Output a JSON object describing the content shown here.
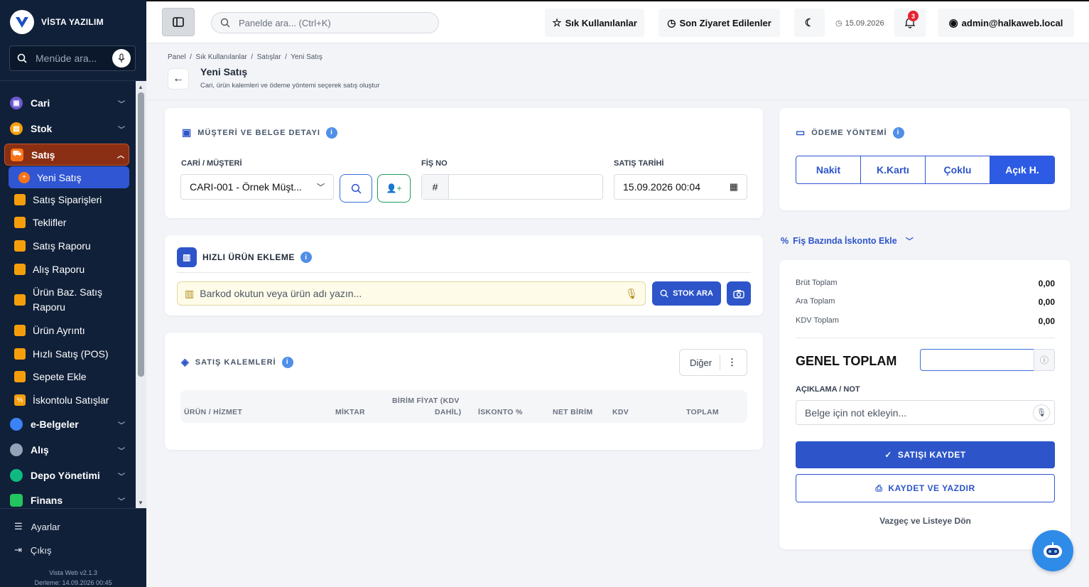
{
  "sidebar": {
    "brand": "VİSTA YAZILIM",
    "search_placeholder": "Menüde ara...",
    "groups": [
      {
        "label": "Cari",
        "color": "#6d5bd0"
      },
      {
        "label": "Stok",
        "color": "#f59e0b"
      },
      {
        "label": "Satış",
        "color": "#f97316"
      }
    ],
    "satis_items": [
      "Yeni Satış",
      "Satış Siparişleri",
      "Teklifler",
      "Satış Raporu",
      "Alış Raporu",
      "Ürün Baz. Satış",
      "Raporu",
      "Ürün Ayrıntı",
      "Hızlı Satış (POS)",
      "Sepete Ekle",
      "İskontolu Satışlar"
    ],
    "groups2": [
      {
        "label": "e-Belgeler",
        "color": "#3b82f6"
      },
      {
        "label": "Alış",
        "color": "#94a3b8"
      },
      {
        "label": "Depo Yönetimi",
        "color": "#10b981"
      },
      {
        "label": "Finans",
        "color": "#22c55e"
      }
    ],
    "settings": "Ayarlar",
    "logout": "Çıkış",
    "version": "Vista Web v2.1.3",
    "build": "Derleme: 14.09.2026 00:45"
  },
  "topbar": {
    "search_placeholder": "Panelde ara... (Ctrl+K)",
    "favorites": "Sık Kullanılanlar",
    "recent": "Son Ziyaret Edilenler",
    "date": "15.09.2026",
    "notif_count": "3",
    "user": "admin@halkaweb.local"
  },
  "page": {
    "breadcrumb": "Panel  /  Sık Kullanılanlar  /  Satışlar  /  Yeni Satış",
    "title": "Yeni Satış",
    "subtitle": "Cari, ürün kalemleri ve ödeme yöntemi seçerek satış oluştur"
  },
  "customer": {
    "title": "MÜŞTERİ VE BELGE DETAYI",
    "cari_label": "CARİ / MÜŞTERİ",
    "cari_value": "CARI-001 - Örnek Müşt...",
    "fis_label": "FİŞ NO",
    "fis_prefix": "#",
    "date_label": "SATIŞ TARİHİ",
    "date_value": "15.09.2026 00:04"
  },
  "quick": {
    "title": "HIZLI ÜRÜN EKLEME",
    "placeholder": "Barkod okutun veya ürün adı yazın...",
    "stock_btn": "STOK ARA"
  },
  "items": {
    "title": "SATIŞ KALEMLERİ",
    "other_btn": "Diğer",
    "headers": [
      "ÜRÜN / HİZMET",
      "MİKTAR",
      "BİRİM FİYAT (KDV",
      "DAHİL)",
      "İSKONTO %",
      "NET BİRİM",
      "KDV",
      "TOPLAM"
    ]
  },
  "payment": {
    "title": "ÖDEME YÖNTEMİ",
    "options": [
      "Nakit",
      "K.Kartı",
      "Çoklu",
      "Açık H."
    ],
    "selected": "Açık H.",
    "discount_link": "Fiş Bazında İskonto Ekle"
  },
  "totals": {
    "brut_label": "Brüt Toplam",
    "brut": "0,00",
    "ara_label": "Ara Toplam",
    "ara": "0,00",
    "kdv_label": "KDV Toplam",
    "kdv": "0,00",
    "genel_label": "GENEL TOPLAM",
    "genel_value": "",
    "note_label": "AÇIKLAMA / NOT",
    "note_placeholder": "Belge için not ekleyin...",
    "save": "SATIŞI KAYDET",
    "save_print": "KAYDET VE YAZDIR",
    "cancel": "Vazgeç ve Listeye Dön"
  }
}
